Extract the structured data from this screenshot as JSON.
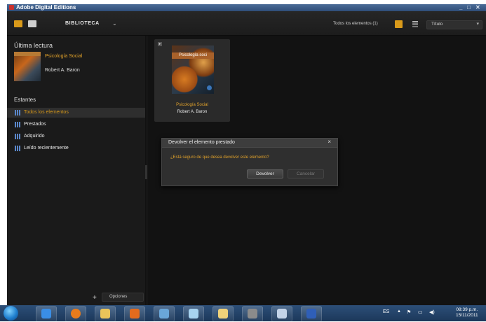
{
  "window": {
    "title": "Adobe Digital Editions",
    "controls": [
      "_",
      "□",
      "✕"
    ]
  },
  "toolbar": {
    "library_label": "BIBLIOTECA",
    "library_chevron": "⌄",
    "all_items_count": "Todos los elementos  (1)",
    "sort_label": "Título",
    "sort_chevron": "▾"
  },
  "sidebar": {
    "last_read_heading": "Última lectura",
    "last_read_title": "Psicología Social",
    "last_read_author": "Robert A. Baron",
    "thumb_band": "PSICOLOGIA SOCIAL",
    "shelves_heading": "Estantes",
    "shelves": [
      {
        "label": "Todos los elementos",
        "selected": true
      },
      {
        "label": "Prestados",
        "selected": false
      },
      {
        "label": "Adquirido",
        "selected": false
      },
      {
        "label": "Leído recientemente",
        "selected": false
      }
    ],
    "add_label": "+",
    "options_label": "Opciones"
  },
  "book": {
    "cover_title": "Psicología soci",
    "title": "Psicología Social",
    "author": "Robert A. Baron"
  },
  "dialog": {
    "title": "Devolver el elemento prestado",
    "close": "×",
    "message": "¿Está seguro de que desea devolver este elemento?",
    "confirm_label": "Devolver",
    "cancel_label": "Cancelar"
  },
  "taskbar": {
    "language": "ES",
    "tray_up": "▲",
    "flag": "⚑",
    "network": "▭",
    "volume": "◀)",
    "time": "08:39 p.m.",
    "date": "15/11/2011"
  },
  "colors": {
    "accent": "#d99a1a",
    "shelf_icon": "#5a86c9"
  },
  "icons": {
    "start": "windows-start-orb",
    "pinned": [
      "internet-explorer-icon",
      "firefox-icon",
      "folder-icon",
      "media-player-icon",
      "network-icon",
      "notepad-icon",
      "folder-open-icon",
      "presentation-icon",
      "paint-icon",
      "word-icon"
    ]
  }
}
